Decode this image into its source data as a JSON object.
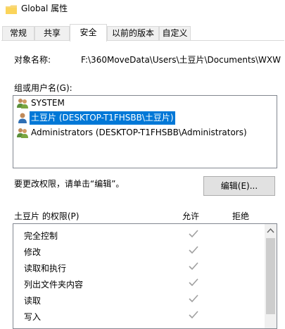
{
  "window": {
    "title": "Global 属性"
  },
  "tabs": [
    {
      "label": "常规"
    },
    {
      "label": "共享"
    },
    {
      "label": "安全"
    },
    {
      "label": "以前的版本"
    },
    {
      "label": "自定义"
    }
  ],
  "security": {
    "object_name_label": "对象名称:",
    "object_name_value": "F:\\360MoveData\\Users\\土豆片\\Documents\\WXW",
    "group_label": "组或用户名(G):",
    "users": [
      {
        "name": "SYSTEM",
        "icon": "users-group-icon"
      },
      {
        "name": "土豆片 (DESKTOP-T1FHSBB\\土豆片)",
        "icon": "user-icon",
        "selected": true
      },
      {
        "name": "Administrators (DESKTOP-T1FHSBB\\Administrators)",
        "icon": "users-group-icon"
      }
    ],
    "change_hint": "要更改权限，请单击“编辑”。",
    "edit_button": "编辑(E)...",
    "permissions_for": "土豆片 的权限(P)",
    "allow_header": "允许",
    "deny_header": "拒绝",
    "permissions": [
      {
        "name": "完全控制",
        "allow": true,
        "deny": false
      },
      {
        "name": "修改",
        "allow": true,
        "deny": false
      },
      {
        "name": "读取和执行",
        "allow": true,
        "deny": false
      },
      {
        "name": "列出文件夹内容",
        "allow": true,
        "deny": false
      },
      {
        "name": "读取",
        "allow": true,
        "deny": false
      },
      {
        "name": "写入",
        "allow": true,
        "deny": false
      }
    ]
  },
  "colors": {
    "selection": "#0078d7",
    "border": "#828790",
    "check": "#a0a0a0"
  }
}
